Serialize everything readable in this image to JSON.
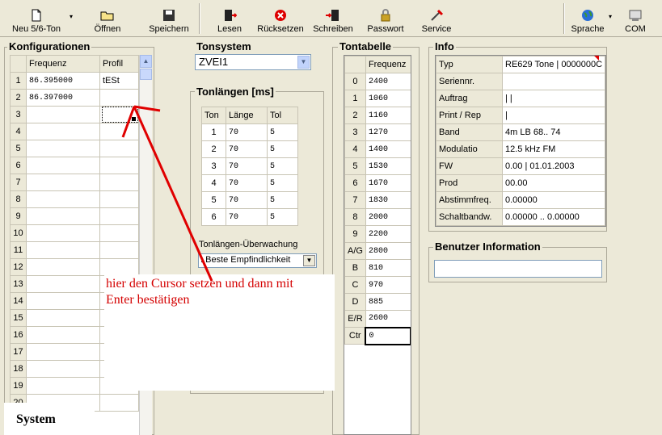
{
  "toolbar": {
    "new_label": "Neu 5/6-Ton",
    "open_label": "Öffnen",
    "save_label": "Speichern",
    "read_label": "Lesen",
    "reset_label": "Rücksetzen",
    "write_label": "Schreiben",
    "password_label": "Passwort",
    "service_label": "Service",
    "language_label": "Sprache",
    "com_label": "COM"
  },
  "config": {
    "title": "Konfigurationen",
    "col_freq": "Frequenz",
    "col_profile": "Profil",
    "rows": [
      {
        "n": "1",
        "freq": "86.395000",
        "profile": "tESt"
      },
      {
        "n": "2",
        "freq": "86.397000",
        "profile": ""
      },
      {
        "n": "3",
        "freq": "",
        "profile": ""
      },
      {
        "n": "4",
        "freq": "",
        "profile": ""
      },
      {
        "n": "5",
        "freq": "",
        "profile": ""
      },
      {
        "n": "6",
        "freq": "",
        "profile": ""
      },
      {
        "n": "7",
        "freq": "",
        "profile": ""
      },
      {
        "n": "8",
        "freq": "",
        "profile": ""
      },
      {
        "n": "9",
        "freq": "",
        "profile": ""
      },
      {
        "n": "10",
        "freq": "",
        "profile": ""
      },
      {
        "n": "11",
        "freq": "",
        "profile": ""
      },
      {
        "n": "12",
        "freq": "",
        "profile": ""
      },
      {
        "n": "13",
        "freq": "",
        "profile": ""
      },
      {
        "n": "14",
        "freq": "",
        "profile": ""
      },
      {
        "n": "15",
        "freq": "",
        "profile": ""
      },
      {
        "n": "16",
        "freq": "",
        "profile": ""
      },
      {
        "n": "17",
        "freq": "",
        "profile": ""
      },
      {
        "n": "18",
        "freq": "",
        "profile": ""
      },
      {
        "n": "19",
        "freq": "",
        "profile": ""
      },
      {
        "n": "20",
        "freq": "",
        "profile": ""
      }
    ]
  },
  "tonsystem": {
    "title": "Tonsystem",
    "value": "ZVEI1"
  },
  "tonlaengen": {
    "title": "Tonlängen [ms]",
    "col_ton": "Ton",
    "col_laenge": "Länge",
    "col_tol": "Tol",
    "rows": [
      [
        "1",
        "70",
        "5"
      ],
      [
        "2",
        "70",
        "5"
      ],
      [
        "3",
        "70",
        "5"
      ],
      [
        "4",
        "70",
        "5"
      ],
      [
        "5",
        "70",
        "5"
      ],
      [
        "6",
        "70",
        "5"
      ]
    ],
    "monitor_label": "Tonlängen-Überwachung",
    "monitor_value": ": Beste Empfindlichkeit"
  },
  "tontabelle": {
    "title": "Tontabelle",
    "col_freq": "Frequenz",
    "rows": [
      [
        "0",
        "2400"
      ],
      [
        "1",
        "1060"
      ],
      [
        "2",
        "1160"
      ],
      [
        "3",
        "1270"
      ],
      [
        "4",
        "1400"
      ],
      [
        "5",
        "1530"
      ],
      [
        "6",
        "1670"
      ],
      [
        "7",
        "1830"
      ],
      [
        "8",
        "2000"
      ],
      [
        "9",
        "2200"
      ],
      [
        "A/G",
        "2800"
      ],
      [
        "B",
        "810"
      ],
      [
        "C",
        "970"
      ],
      [
        "D",
        "885"
      ],
      [
        "E/R",
        "2600"
      ],
      [
        "Ctr",
        "0"
      ]
    ]
  },
  "info": {
    "title": "Info",
    "rows": [
      [
        "Typ",
        "RE629 Tone | 0000000C"
      ],
      [
        "Seriennr.",
        ""
      ],
      [
        "Auftrag",
        "|  |"
      ],
      [
        "Print / Rep",
        "    |"
      ],
      [
        "Band",
        "4m LB   68.. 74"
      ],
      [
        "Modulatio",
        "12.5 kHz  FM"
      ],
      [
        "FW",
        "0.00 | 01.01.2003"
      ],
      [
        "Prod",
        "00.00"
      ],
      [
        "Abstimmfreq.",
        "0.00000"
      ],
      [
        "Schaltbandw.",
        "0.00000 .. 0.00000"
      ]
    ]
  },
  "benutzer": {
    "title": "Benutzer Information",
    "value": ""
  },
  "annotation": {
    "line1": "hier den Cursor setzen und dann mit",
    "line2": "Enter bestätigen"
  },
  "system_label": "System"
}
